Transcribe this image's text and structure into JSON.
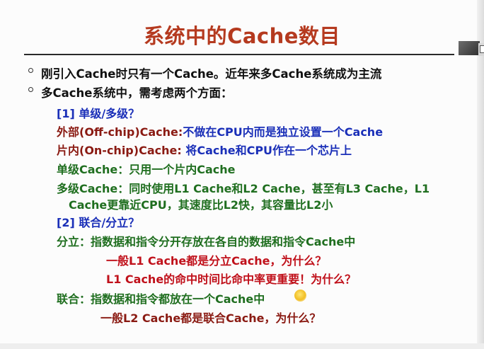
{
  "title": "系统中的Cache数目",
  "lines": {
    "b1": "刚引入Cache时只有一个Cache。近年来多Cache系统成为主流",
    "b2": "多Cache系统中，需考虑两个方面：",
    "h1": "[1] 单级/多级？",
    "off_label": "外部(Off-chip)Cache:",
    "off_text": "不做在CPU内而是独立设置一个Cache",
    "on_label": "片内(On-chip)Cache:",
    "on_text": " 将Cache和CPU作在一个芯片上",
    "single": "单级Cache：只用一个片内Cache",
    "multi1": "多级Cache：同时使用L1 Cache和L2 Cache，甚至有L3 Cache，L1",
    "multi2": "Cache更靠近CPU，其速度比L2快，其容量比L2小",
    "h2": "[2] 联合/分立？",
    "split": "分立：指数据和指令分开存放在各自的数据和指令Cache中",
    "split_q1": "一般L1 Cache都是分立Cache，为什么？",
    "split_q2": "L1 Cache的命中时间比命中率更重要！为什么？",
    "unified": "联合：指数据和指令都放在一个Cache中",
    "unified_q": "一般L2 Cache都是联合Cache，为什么？"
  },
  "colors": {
    "title": "#b53a1f",
    "black": "#111111",
    "blue": "#1a2fb8",
    "darkred": "#8a1a12",
    "green": "#1f6e1f",
    "red": "#c0101a"
  }
}
